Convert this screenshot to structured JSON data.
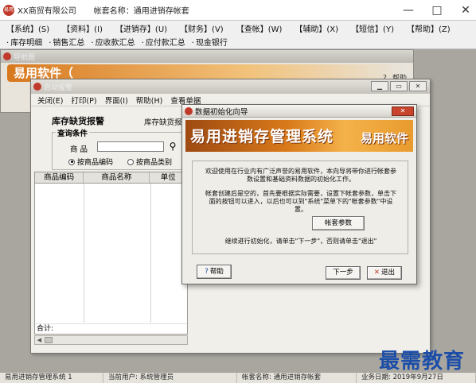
{
  "main_window": {
    "logo_text": "易用",
    "company": "XX商贸有限公司",
    "account_set": "帐套名称：通用进销存帐套",
    "controls": {
      "minimize": "—",
      "maximize": "□",
      "close": "✕"
    }
  },
  "main_menu": [
    "【系统】(S)",
    "【资料】(I)",
    "【进销存】(U)",
    "【财务】(V)",
    "【查帐】(W)",
    "【辅助】(X)",
    "【短信】(Y)",
    "【帮助】(Z)"
  ],
  "main_toolbar": [
    "库存明细",
    "销售汇总",
    "应收款汇总",
    "应付款汇总",
    "现金银行"
  ],
  "navigator": {
    "title": "导航图",
    "banner": "易用软件（",
    "help_link": "？ 帮助"
  },
  "stock_window": {
    "title": "启动报警",
    "menu": [
      "关闭(E)",
      "打印(P)",
      "界面(I)",
      "帮助(H)",
      "查看单据"
    ],
    "heading": "库存缺货报警",
    "heading_2": "库存缺货报",
    "query": {
      "legend": "查询条件",
      "goods_label": "商品",
      "goods_value": "",
      "radio_1": "按商品编码",
      "radio_2": "按商品类别"
    },
    "table_headers": [
      "商品编码",
      "商品名称",
      "单位"
    ],
    "total_label": "合计:",
    "scroll_left": "◀"
  },
  "wizard": {
    "title": "数据初始化向导",
    "close_label": "✕",
    "banner_title": "易用进销存管理系统",
    "banner_brand": "易用软件",
    "paragraph_1": "欢迎使用在行业内有广泛声誉的易用软件，本向导将带你进行帐套参数设置和基础资料数据的初始化工作。",
    "paragraph_2": "帐套创建后是空的，首先要根据实际需要，设置下帐套参数，单击下面的按钮可以进入，以后也可以到\"系统\"菜单下的\"帐套参数\"中设置。",
    "param_button": "帐套参数",
    "paragraph_3": "继续进行初始化，请单击\"下一步\"，否则请单击\"退出\"",
    "help_button": "帮助",
    "next_button": "下一步",
    "exit_button": "退出"
  },
  "statusbar": [
    "易用进销存管理系统 1",
    "当前用户: 系统管理员",
    "帐套名称: 通用进销存帐套",
    "业务日期: 2019年9月27日"
  ],
  "watermark": "最需教育"
}
